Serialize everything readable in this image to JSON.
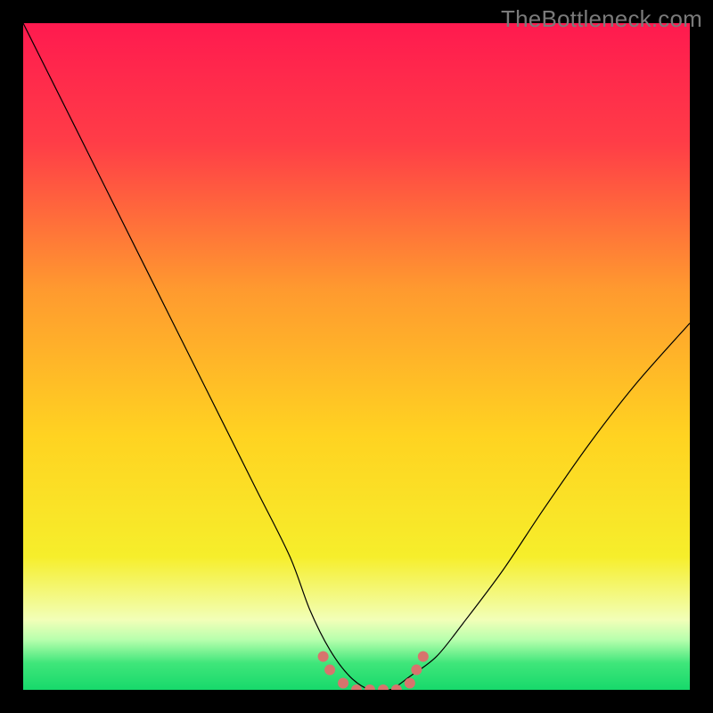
{
  "watermark": "TheBottleneck.com",
  "chart_data": {
    "type": "line",
    "title": "",
    "xlabel": "",
    "ylabel": "",
    "xlim": [
      0,
      100
    ],
    "ylim": [
      0,
      100
    ],
    "grid": false,
    "background_gradient": {
      "stops": [
        {
          "offset": 0.0,
          "color": "#ff1a4f"
        },
        {
          "offset": 0.18,
          "color": "#ff3d47"
        },
        {
          "offset": 0.4,
          "color": "#ff9a2f"
        },
        {
          "offset": 0.62,
          "color": "#ffd321"
        },
        {
          "offset": 0.8,
          "color": "#f6ee2b"
        },
        {
          "offset": 0.895,
          "color": "#f2ffb8"
        },
        {
          "offset": 0.925,
          "color": "#b7ffad"
        },
        {
          "offset": 0.96,
          "color": "#3fe67a"
        },
        {
          "offset": 1.0,
          "color": "#17d96b"
        }
      ]
    },
    "series": [
      {
        "name": "bottleneck-curve",
        "color": "#000000",
        "width": 1.2,
        "x": [
          0,
          5,
          10,
          15,
          20,
          25,
          30,
          35,
          40,
          43,
          46,
          49,
          52,
          55,
          58,
          62,
          66,
          72,
          78,
          85,
          92,
          100
        ],
        "y": [
          100,
          90,
          80,
          70,
          60,
          50,
          40,
          30,
          20,
          12,
          6,
          2,
          0,
          0,
          2,
          5,
          10,
          18,
          27,
          37,
          46,
          55
        ]
      }
    ],
    "markers": [
      {
        "name": "flat-region-dots",
        "color": "#d7746d",
        "radius": 6,
        "points": [
          {
            "x": 45,
            "y": 5
          },
          {
            "x": 46,
            "y": 3
          },
          {
            "x": 48,
            "y": 1
          },
          {
            "x": 50,
            "y": 0
          },
          {
            "x": 52,
            "y": 0
          },
          {
            "x": 54,
            "y": 0
          },
          {
            "x": 56,
            "y": 0
          },
          {
            "x": 58,
            "y": 1
          },
          {
            "x": 59,
            "y": 3
          },
          {
            "x": 60,
            "y": 5
          }
        ]
      }
    ]
  }
}
